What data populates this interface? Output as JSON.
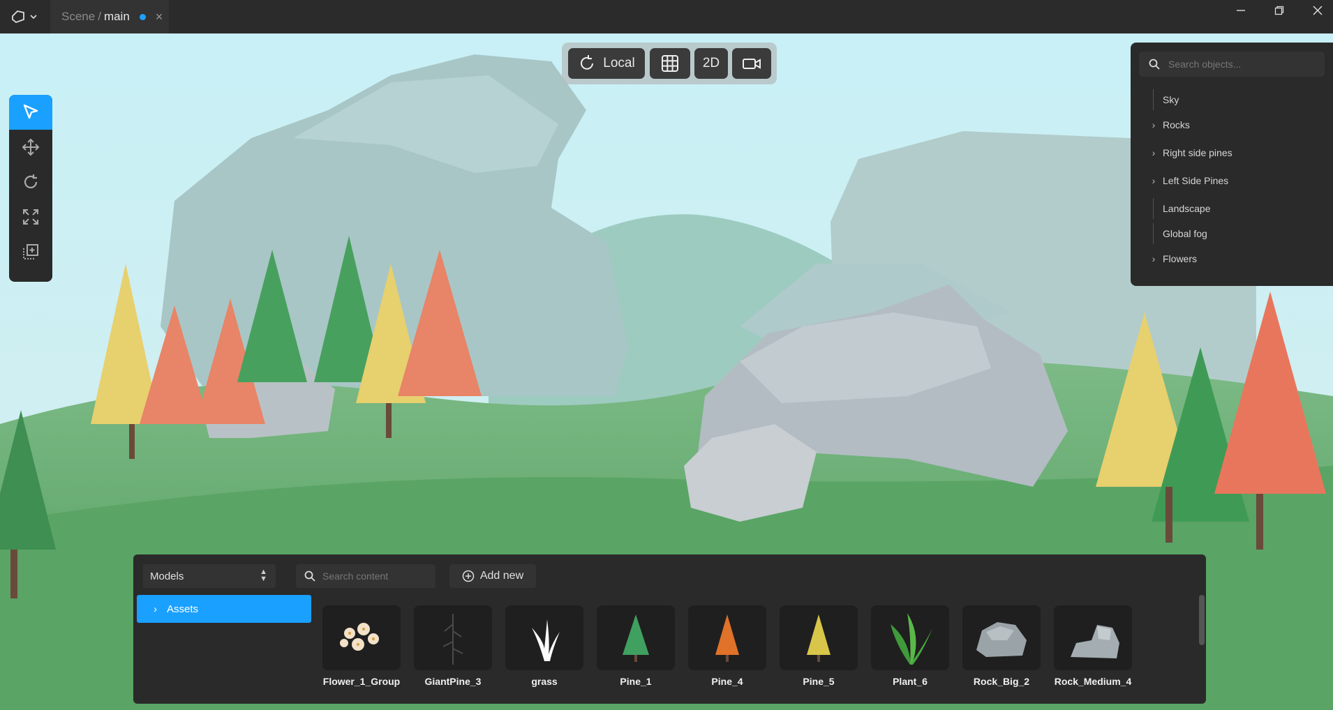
{
  "tab": {
    "crumb": "Scene",
    "separator": "/",
    "name": "main",
    "close": "×"
  },
  "window_controls": [
    "minimize-icon",
    "restore-icon",
    "close-icon"
  ],
  "left_tools": [
    "select-cursor-icon",
    "move-icon",
    "rotate-icon",
    "scale-icon",
    "add-object-icon"
  ],
  "top_tools": {
    "space_label": "Local",
    "view_2d_label": "2D",
    "icons": [
      "rotate-space-icon",
      "grid-icon",
      "camera-icon"
    ]
  },
  "outliner": {
    "search_placeholder": "Search objects...",
    "items": [
      {
        "label": "Sky",
        "expandable": false
      },
      {
        "label": "Rocks",
        "expandable": true
      },
      {
        "label": "Right side pines",
        "expandable": true
      },
      {
        "label": "Left Side Pines",
        "expandable": true
      },
      {
        "label": "Landscape",
        "expandable": false
      },
      {
        "label": "Global fog",
        "expandable": false
      },
      {
        "label": "Flowers",
        "expandable": true
      }
    ]
  },
  "assets_panel": {
    "type_select": "Models",
    "search_placeholder": "Search content",
    "add_new_label": "Add new",
    "folder": "Assets",
    "items": [
      "Flower_1_Group",
      "GiantPine_3",
      "grass",
      "Pine_1",
      "Pine_4",
      "Pine_5",
      "Plant_6",
      "Rock_Big_2",
      "Rock_Medium_4"
    ]
  },
  "colors": {
    "accent": "#1aa0ff",
    "panel": "#2a2a2a",
    "sky": "#cdeff4",
    "grass": "#5fa86a",
    "pine_green": "#3c9a58",
    "pine_orange": "#e6725a",
    "pine_yellow": "#e8d070",
    "rock": "#a8b4ba"
  }
}
